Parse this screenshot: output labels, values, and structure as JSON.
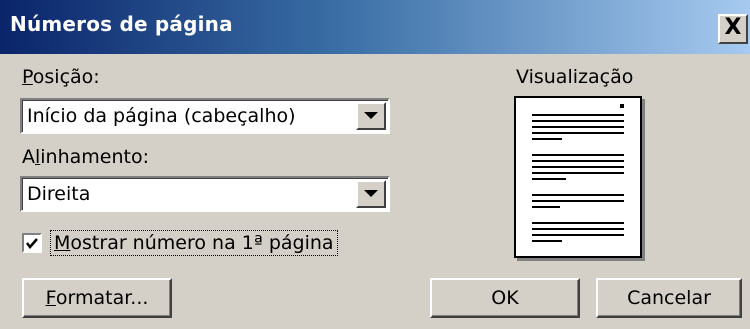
{
  "window": {
    "title": "Números de página",
    "close_glyph": "X"
  },
  "position": {
    "label_first": "P",
    "label_rest": "osição:",
    "value": "Início da página (cabeçalho)"
  },
  "alignment": {
    "label_pre": "A",
    "label_key": "l",
    "label_rest": "inhamento:",
    "value": "Direita"
  },
  "show_first_page": {
    "checked": true,
    "label_first": "M",
    "label_rest": "ostrar número na 1ª página"
  },
  "preview": {
    "label": "Visualização"
  },
  "buttons": {
    "format_first": "F",
    "format_rest": "ormatar...",
    "ok": "OK",
    "cancel": "Cancelar"
  },
  "icons": {
    "close": "close-icon",
    "dropdown": "chevron-down-icon",
    "check": "check-icon"
  }
}
